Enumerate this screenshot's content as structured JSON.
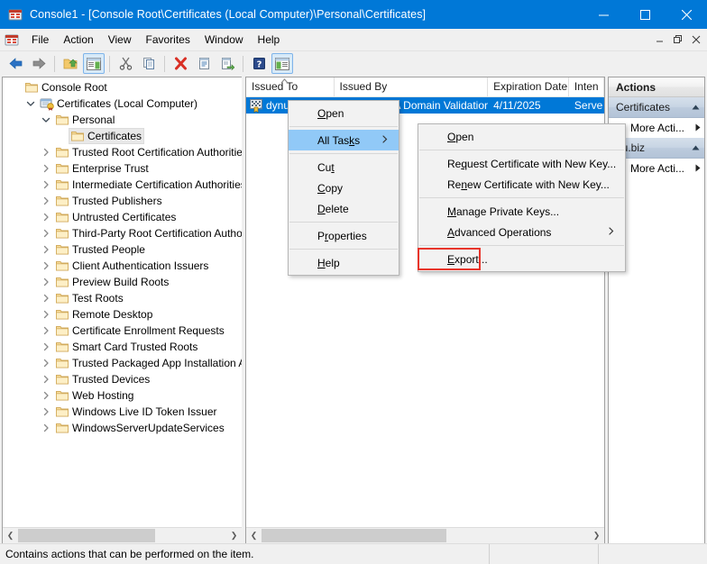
{
  "window": {
    "title": "Console1 - [Console Root\\Certificates (Local Computer)\\Personal\\Certificates]",
    "icon": "mmc-console-icon",
    "minimize_label": "─",
    "maximize_label": "□",
    "close_label": "✕",
    "accent_color": "#0078d7"
  },
  "menubar": {
    "items": [
      {
        "label": "File",
        "accel": "F"
      },
      {
        "label": "Action",
        "accel": "A"
      },
      {
        "label": "View",
        "accel": "V"
      },
      {
        "label": "Favorites",
        "accel": "o"
      },
      {
        "label": "Window",
        "accel": "W"
      },
      {
        "label": "Help",
        "accel": "H"
      }
    ],
    "mdi_minimize": "–",
    "mdi_restore": "❐",
    "mdi_close": "✕"
  },
  "toolbar": {
    "buttons": [
      {
        "name": "back-button",
        "icon": "left-arrow-icon",
        "pressed": false
      },
      {
        "name": "forward-button",
        "icon": "right-arrow-icon",
        "pressed": false
      },
      {
        "name": "up-one-level-button",
        "icon": "folder-up-icon",
        "pressed": false
      },
      {
        "name": "show-hide-console-tree-button",
        "icon": "console-tree-icon",
        "pressed": true
      },
      {
        "name": "cut-button",
        "icon": "scissors-icon",
        "pressed": false
      },
      {
        "name": "copy-button",
        "icon": "copy-icon",
        "pressed": false
      },
      {
        "name": "delete-button",
        "icon": "red-x-icon",
        "pressed": false
      },
      {
        "name": "properties-button",
        "icon": "properties-icon",
        "pressed": false
      },
      {
        "name": "export-list-button",
        "icon": "export-list-icon",
        "pressed": false
      },
      {
        "name": "help-button",
        "icon": "blue-question-icon",
        "pressed": false
      },
      {
        "name": "show-hide-action-pane-button",
        "icon": "action-pane-icon",
        "pressed": true
      }
    ]
  },
  "tree": {
    "items": [
      {
        "label": "Console Root",
        "depth": 0,
        "twisty": "none",
        "icon": "folder-icon",
        "selected": false
      },
      {
        "label": "Certificates (Local Computer)",
        "depth": 1,
        "twisty": "expanded",
        "icon": "cert-store-icon",
        "selected": false
      },
      {
        "label": "Personal",
        "depth": 2,
        "twisty": "expanded",
        "icon": "folder-icon",
        "selected": false
      },
      {
        "label": "Certificates",
        "depth": 3,
        "twisty": "none",
        "icon": "folder-icon",
        "selected": true
      },
      {
        "label": "Trusted Root Certification Authorities",
        "depth": 2,
        "twisty": "collapsed",
        "icon": "folder-icon",
        "selected": false
      },
      {
        "label": "Enterprise Trust",
        "depth": 2,
        "twisty": "collapsed",
        "icon": "folder-icon",
        "selected": false
      },
      {
        "label": "Intermediate Certification Authorities",
        "depth": 2,
        "twisty": "collapsed",
        "icon": "folder-icon",
        "selected": false
      },
      {
        "label": "Trusted Publishers",
        "depth": 2,
        "twisty": "collapsed",
        "icon": "folder-icon",
        "selected": false
      },
      {
        "label": "Untrusted Certificates",
        "depth": 2,
        "twisty": "collapsed",
        "icon": "folder-icon",
        "selected": false
      },
      {
        "label": "Third-Party Root Certification Authorities",
        "depth": 2,
        "twisty": "collapsed",
        "icon": "folder-icon",
        "selected": false
      },
      {
        "label": "Trusted People",
        "depth": 2,
        "twisty": "collapsed",
        "icon": "folder-icon",
        "selected": false
      },
      {
        "label": "Client Authentication Issuers",
        "depth": 2,
        "twisty": "collapsed",
        "icon": "folder-icon",
        "selected": false
      },
      {
        "label": "Preview Build Roots",
        "depth": 2,
        "twisty": "collapsed",
        "icon": "folder-icon",
        "selected": false
      },
      {
        "label": "Test Roots",
        "depth": 2,
        "twisty": "collapsed",
        "icon": "folder-icon",
        "selected": false
      },
      {
        "label": "Remote Desktop",
        "depth": 2,
        "twisty": "collapsed",
        "icon": "folder-icon",
        "selected": false
      },
      {
        "label": "Certificate Enrollment Requests",
        "depth": 2,
        "twisty": "collapsed",
        "icon": "folder-icon",
        "selected": false
      },
      {
        "label": "Smart Card Trusted Roots",
        "depth": 2,
        "twisty": "collapsed",
        "icon": "folder-icon",
        "selected": false
      },
      {
        "label": "Trusted Packaged App Installation Authorit",
        "depth": 2,
        "twisty": "collapsed",
        "icon": "folder-icon",
        "selected": false
      },
      {
        "label": "Trusted Devices",
        "depth": 2,
        "twisty": "collapsed",
        "icon": "folder-icon",
        "selected": false
      },
      {
        "label": "Web Hosting",
        "depth": 2,
        "twisty": "collapsed",
        "icon": "folder-icon",
        "selected": false
      },
      {
        "label": "Windows Live ID Token Issuer",
        "depth": 2,
        "twisty": "collapsed",
        "icon": "folder-icon",
        "selected": false
      },
      {
        "label": "WindowsServerUpdateServices",
        "depth": 2,
        "twisty": "collapsed",
        "icon": "folder-icon",
        "selected": false
      }
    ]
  },
  "list": {
    "columns": [
      {
        "label": "Issued To",
        "width": 100,
        "sorted": true
      },
      {
        "label": "Issued By",
        "width": 175,
        "sorted": false
      },
      {
        "label": "Expiration Date",
        "width": 92,
        "sorted": false
      },
      {
        "label": "Inten",
        "width": 40,
        "sorted": false
      }
    ],
    "rows": [
      {
        "selected": true,
        "icon": "certificate-icon",
        "issued_to": "dynu.biz",
        "issued_by": "Sectigo RSA Domain Validation Se...",
        "expiration_date": "4/11/2025",
        "intended_purposes": "Serve"
      }
    ]
  },
  "actions": {
    "title": "Actions",
    "groups": [
      {
        "header": "Certificates",
        "collapse_caret": "▲",
        "items": [
          {
            "label": "More Acti...",
            "has_submenu": true,
            "caret": "▶"
          }
        ]
      },
      {
        "header": "nu.biz",
        "collapse_caret": "▲",
        "items": [
          {
            "label": "More Acti...",
            "has_submenu": true,
            "caret": "▶"
          }
        ]
      }
    ]
  },
  "context_menu": {
    "items": [
      {
        "label_pre": "",
        "accel": "O",
        "label_post": "pen",
        "type": "item",
        "highlighted": false,
        "has_submenu": false
      },
      {
        "type": "sep"
      },
      {
        "label_pre": "All Tas",
        "accel": "k",
        "label_post": "s",
        "type": "item",
        "highlighted": true,
        "has_submenu": true,
        "arrow": "›"
      },
      {
        "type": "sep"
      },
      {
        "label_pre": "Cu",
        "accel": "t",
        "label_post": "",
        "type": "item",
        "highlighted": false,
        "has_submenu": false
      },
      {
        "label_pre": "",
        "accel": "C",
        "label_post": "opy",
        "type": "item",
        "highlighted": false,
        "has_submenu": false
      },
      {
        "label_pre": "",
        "accel": "D",
        "label_post": "elete",
        "type": "item",
        "highlighted": false,
        "has_submenu": false
      },
      {
        "type": "sep"
      },
      {
        "label_pre": "P",
        "accel": "r",
        "label_post": "operties",
        "type": "item",
        "highlighted": false,
        "has_submenu": false
      },
      {
        "type": "sep"
      },
      {
        "label_pre": "",
        "accel": "H",
        "label_post": "elp",
        "type": "item",
        "highlighted": false,
        "has_submenu": false
      }
    ]
  },
  "submenu": {
    "items": [
      {
        "label_pre": "",
        "accel": "O",
        "label_post": "pen",
        "type": "item",
        "has_submenu": false,
        "boxed": false
      },
      {
        "type": "sep"
      },
      {
        "label_pre": "Re",
        "accel": "q",
        "label_post": "uest Certificate with New Key...",
        "type": "item",
        "has_submenu": false,
        "boxed": false
      },
      {
        "label_pre": "Re",
        "accel": "n",
        "label_post": "ew Certificate with New Key...",
        "type": "item",
        "has_submenu": false,
        "boxed": false
      },
      {
        "type": "sep"
      },
      {
        "label_pre": "",
        "accel": "M",
        "label_post": "anage Private Keys...",
        "type": "item",
        "has_submenu": false,
        "boxed": false
      },
      {
        "label_pre": "",
        "accel": "A",
        "label_post": "dvanced Operations",
        "type": "item",
        "has_submenu": true,
        "arrow": "›",
        "boxed": false
      },
      {
        "type": "sep"
      },
      {
        "label_pre": "",
        "accel": "E",
        "label_post": "xport...",
        "type": "item",
        "has_submenu": false,
        "boxed": true
      }
    ],
    "highlight_box_color": "#e8342a"
  },
  "statusbar": {
    "text": "Contains actions that can be performed on the item."
  }
}
